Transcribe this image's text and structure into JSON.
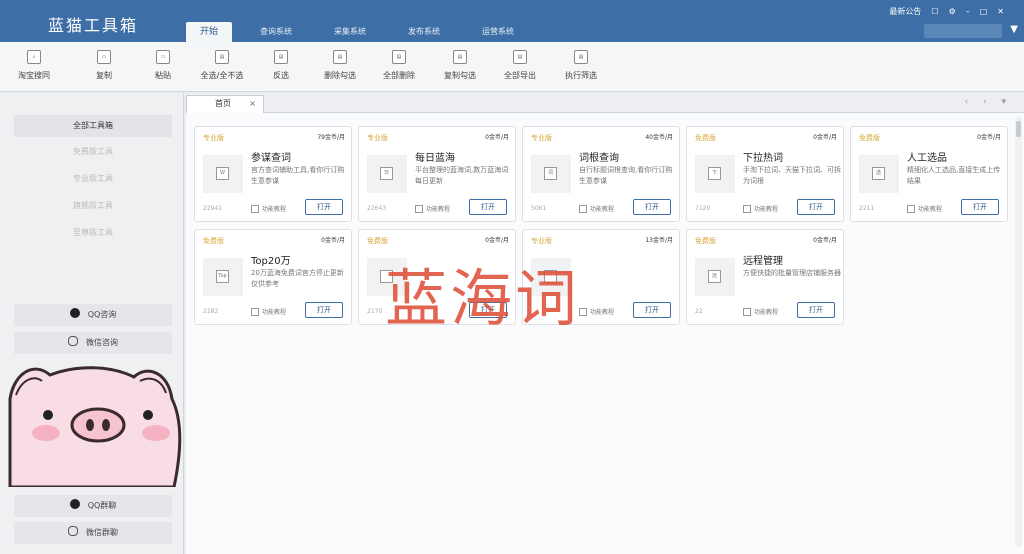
{
  "app": {
    "title": "蓝猫工具箱"
  },
  "menu_tabs": [
    "开始",
    "查询系统",
    "采集系统",
    "发布系统",
    "运营系统"
  ],
  "top_controls": {
    "announcement": "最新公告"
  },
  "toolbar": [
    {
      "label": "淘宝搜同",
      "icon": "search-icon"
    },
    {
      "label": "复制",
      "icon": "copy-icon"
    },
    {
      "label": "粘贴",
      "icon": "paste-icon"
    },
    {
      "label": "全选/全不选",
      "icon": "select-all-icon"
    },
    {
      "label": "反选",
      "icon": "invert-selection-icon"
    },
    {
      "label": "删除勾选",
      "icon": "delete-checked-icon"
    },
    {
      "label": "全部删除",
      "icon": "delete-all-icon"
    },
    {
      "label": "复制勾选",
      "icon": "copy-checked-icon"
    },
    {
      "label": "全部导出",
      "icon": "export-all-icon"
    },
    {
      "label": "执行筛选",
      "icon": "filter-icon"
    }
  ],
  "sidebar": {
    "items": [
      "全部工具箱",
      "免费版工具",
      "专业版工具",
      "旗舰版工具",
      "至尊版工具"
    ],
    "contacts": [
      "QQ咨询",
      "微信咨询"
    ],
    "groups": [
      "QQ群聊",
      "微信群聊"
    ]
  },
  "page_tab": {
    "label": "首页",
    "close": "×"
  },
  "tab_nav": "‹ › ▾",
  "open_label": "打开",
  "guide_label": "功能教程",
  "cards": [
    {
      "badge": "专业版",
      "price": "79金币/月",
      "title": "参谋查词",
      "desc": "官方查词辅助工具,看你行订购生意参谋",
      "views": "22941",
      "icon": "W"
    },
    {
      "badge": "专业版",
      "price": "0金币/月",
      "title": "每日蓝海",
      "desc": "平台整理的蓝海词,数万蓝海词每日更新",
      "views": "22643",
      "icon": "日"
    },
    {
      "badge": "专业版",
      "price": "40金币/月",
      "title": "词根查询",
      "desc": "自行标题词根查询,看你行订购生意参谋",
      "views": "5061",
      "icon": "词"
    },
    {
      "badge": "免费版",
      "price": "0金币/月",
      "title": "下拉热词",
      "desc": "手淘下拉词、天猫下拉词、可拆为词根",
      "views": "7120",
      "icon": "下"
    },
    {
      "badge": "免费版",
      "price": "0金币/月",
      "title": "人工选品",
      "desc": "精细化人工选品,直接生成上传结果",
      "views": "2211",
      "icon": "选"
    },
    {
      "badge": "免费版",
      "price": "0金币/月",
      "title": "Top20万",
      "desc": "20万蓝海免费词官方停止更新仅供参考",
      "views": "2182",
      "icon": "Top"
    },
    {
      "badge": "免费版",
      "price": "0金币/月",
      "title": "",
      "desc": "",
      "views": "2170",
      "icon": ""
    },
    {
      "badge": "专业版",
      "price": "13金币/月",
      "title": "",
      "desc": "",
      "views": "",
      "icon": ""
    },
    {
      "badge": "免费版",
      "price": "0金币/月",
      "title": "远程管理",
      "desc": "方便快捷的批量管理店铺服务器",
      "views": "22",
      "icon": "远"
    }
  ],
  "watermark": "蓝海词"
}
